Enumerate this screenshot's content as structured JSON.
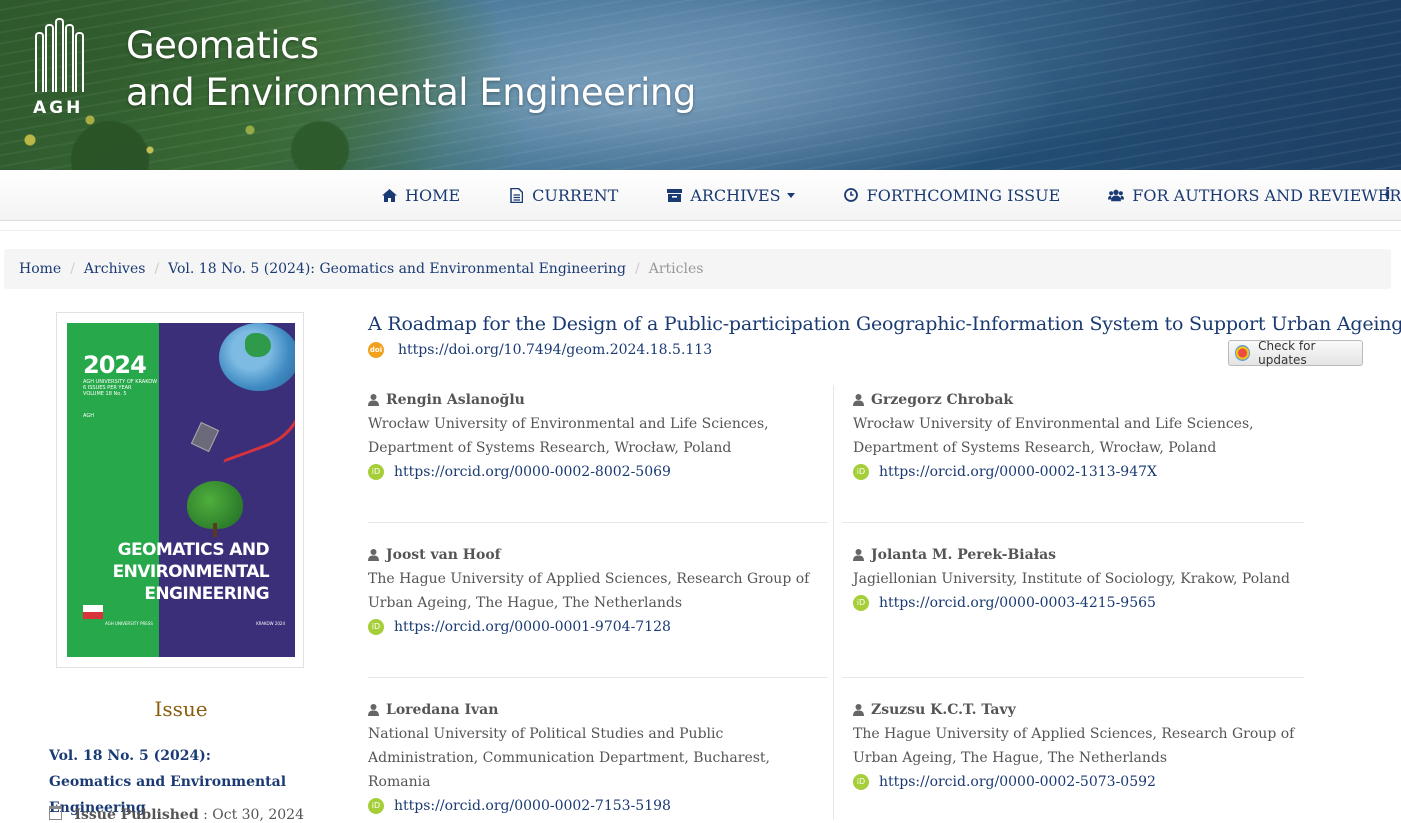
{
  "header": {
    "logo_text": "AGH",
    "journal_title_line1": "Geomatics",
    "journal_title_line2": "and Environmental Engineering"
  },
  "nav": {
    "items": [
      {
        "label": "HOME",
        "icon": "home-icon"
      },
      {
        "label": "CURRENT",
        "icon": "document-icon"
      },
      {
        "label": "ARCHIVES",
        "icon": "archive-icon",
        "dropdown": true
      },
      {
        "label": "FORTHCOMING ISSUE",
        "icon": "clock-icon"
      },
      {
        "label": "FOR AUTHORS AND REVIEWERS",
        "icon": "users-icon",
        "dropdown": true
      }
    ]
  },
  "breadcrumb": {
    "home": "Home",
    "archives": "Archives",
    "issue": "Vol. 18 No. 5 (2024): Geomatics and Environmental Engineering",
    "current": "Articles"
  },
  "sidebar": {
    "cover": {
      "year": "2024",
      "subtitle_lines": [
        "AGH UNIVERSITY OF KRAKOW",
        "6 ISSUES PER YEAR",
        "VOLUME 18 No. 5"
      ],
      "logo": "AGH",
      "title": "GEOMATICS AND ENVIRONMENTAL ENGINEERING",
      "press": "AGH UNIVERSITY PRESS",
      "place": "KRAKOW 2024"
    },
    "issue_heading": "Issue",
    "issue_link": "Vol. 18 No. 5 (2024): Geomatics and Environmental Engineering",
    "published_label": "Issue Published",
    "published_date": "Oct 30, 2024"
  },
  "article": {
    "title": "A Roadmap for the Design of a Public-participation Geographic-Information System to Support Urban Ageing",
    "doi": "https://doi.org/10.7494/geom.2024.18.5.113",
    "check_updates": "Check for updates",
    "authors": [
      {
        "name": "Rengin Aslanoğlu",
        "affiliation": "Wrocław University of Environmental and Life Sciences, Department of Systems Research, Wrocław, Poland",
        "orcid": "https://orcid.org/0000-0002-8002-5069"
      },
      {
        "name": "Grzegorz Chrobak",
        "affiliation": "Wrocław University of Environmental and Life Sciences, Department of Systems Research, Wrocław, Poland",
        "orcid": "https://orcid.org/0000-0002-1313-947X"
      },
      {
        "name": "Joost van Hoof",
        "affiliation": "The Hague University of Applied Sciences, Research Group of Urban Ageing, The Hague, The Netherlands",
        "orcid": "https://orcid.org/0000-0001-9704-7128"
      },
      {
        "name": "Jolanta M. Perek-Białas",
        "affiliation": "Jagiellonian University, Institute of Sociology, Krakow, Poland",
        "orcid": "https://orcid.org/0000-0003-4215-9565"
      },
      {
        "name": "Loredana Ivan",
        "affiliation": "National University of Political Studies and Public Administration, Communication Department, Bucharest, Romania",
        "orcid": "https://orcid.org/0000-0002-7153-5198"
      },
      {
        "name": "Zsuzsu K.C.T. Tavy",
        "affiliation": "The Hague University of Applied Sciences, Research Group of Urban Ageing, The Hague, The Netherlands",
        "orcid": "https://orcid.org/0000-0002-5073-0592"
      }
    ]
  },
  "colors": {
    "link": "#1a3a73",
    "issue_heading": "#8b5e0e",
    "orcid": "#a6ce39",
    "doi_badge": "#f2a11c"
  }
}
